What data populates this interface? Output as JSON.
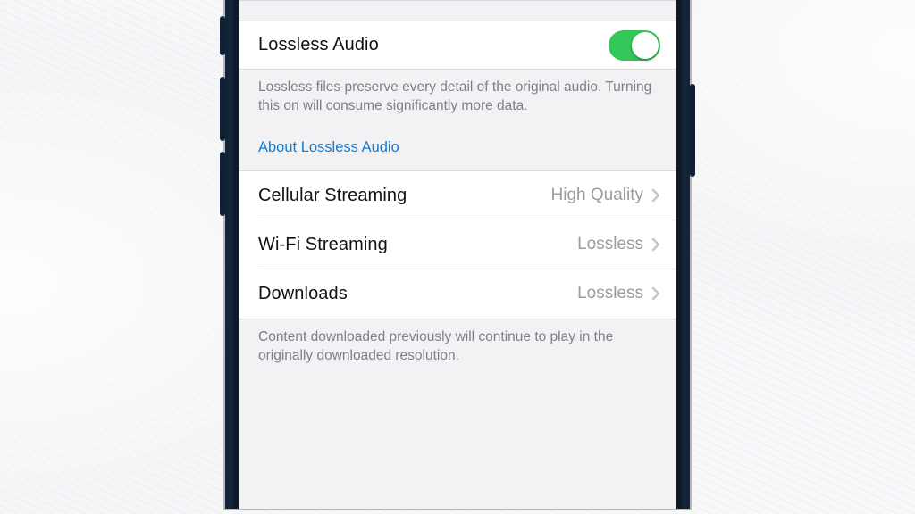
{
  "lossless": {
    "label": "Lossless Audio",
    "enabled": true,
    "description": "Lossless files preserve every detail of the original audio. Turning this on will consume significantly more data.",
    "learn_more_label": "About Lossless Audio"
  },
  "quality_rows": [
    {
      "label": "Cellular Streaming",
      "value": "High Quality"
    },
    {
      "label": "Wi-Fi Streaming",
      "value": "Lossless"
    },
    {
      "label": "Downloads",
      "value": "Lossless"
    }
  ],
  "downloads_note": "Content downloaded previously will continue to play in the originally downloaded resolution."
}
